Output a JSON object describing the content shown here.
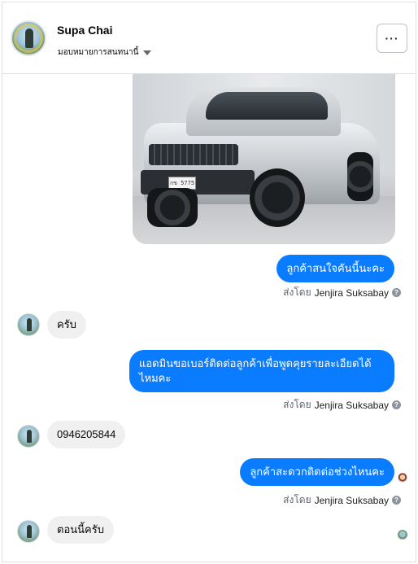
{
  "header": {
    "contact_name": "Supa Chai",
    "assign_label": "มอบหมายการสนทนานี้",
    "more_label": "···"
  },
  "car_image": {
    "plate_text": "กข 5775"
  },
  "messages": [
    {
      "direction": "outgoing",
      "text": "ลูกค้าสนใจคันนี้นะคะ",
      "sent_by_prefix": "ส่งโดย",
      "sent_by_agent": "Jenjira Suksabay"
    },
    {
      "direction": "incoming",
      "text": "ครับ"
    },
    {
      "direction": "outgoing",
      "text": "แอดมินขอเบอร์ติดต่อลูกค้าเพื่อพูดคุยรายละเอียดได้ไหมคะ",
      "sent_by_prefix": "ส่งโดย",
      "sent_by_agent": "Jenjira Suksabay"
    },
    {
      "direction": "incoming",
      "text": "0946205844"
    },
    {
      "direction": "outgoing",
      "text": "ลูกค้าสะดวกติดต่อช่วงไหนคะ",
      "sent_by_prefix": "ส่งโดย",
      "sent_by_agent": "Jenjira Suksabay"
    },
    {
      "direction": "incoming",
      "text": "ตอนนี้ครับ"
    }
  ],
  "icons": {
    "help": "question-circle-icon",
    "more": "ellipsis-icon",
    "caret": "caret-down-icon"
  },
  "colors": {
    "outgoing_bubble": "#0a7cff",
    "incoming_bubble": "#f0f0f0",
    "meta_text": "#606770"
  }
}
